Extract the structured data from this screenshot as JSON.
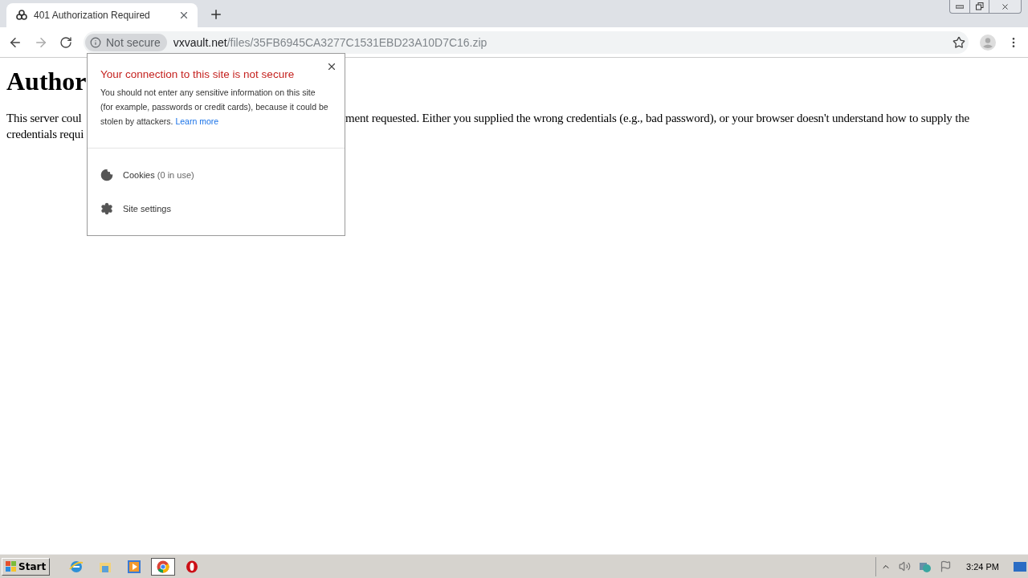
{
  "tabs": [
    {
      "title": "401 Authorization Required",
      "selected": true
    }
  ],
  "address": {
    "security_chip": "Not secure",
    "host": "vxvault.net",
    "path": "/files/35FB6945CA3277C1531EBD23A10D7C16.zip"
  },
  "page": {
    "heading": "Author",
    "left_lines": [
      "This server coul",
      "credentials requi"
    ],
    "right_lines": [
      "ment requested. Either you supplied the wrong credentials (e.g., bad password), or your browser doesn't understand how to supply the"
    ]
  },
  "popup": {
    "title": "Your connection to this site is not secure",
    "body": "You should not enter any sensitive information on this site (for example, passwords or credit cards), because it could be stolen by attackers.",
    "link": "Learn more",
    "items": [
      {
        "kind": "cookies",
        "label": "Cookies",
        "detail": "(0 in use)"
      },
      {
        "kind": "settings",
        "label": "Site settings"
      }
    ]
  },
  "taskbar": {
    "start": "Start",
    "apps": [
      {
        "kind": "ie",
        "selected": false
      },
      {
        "kind": "explorer",
        "selected": false
      },
      {
        "kind": "media",
        "selected": false
      },
      {
        "kind": "chrome",
        "selected": true
      },
      {
        "kind": "opera",
        "selected": false
      }
    ],
    "clock": "3:24 PM"
  }
}
